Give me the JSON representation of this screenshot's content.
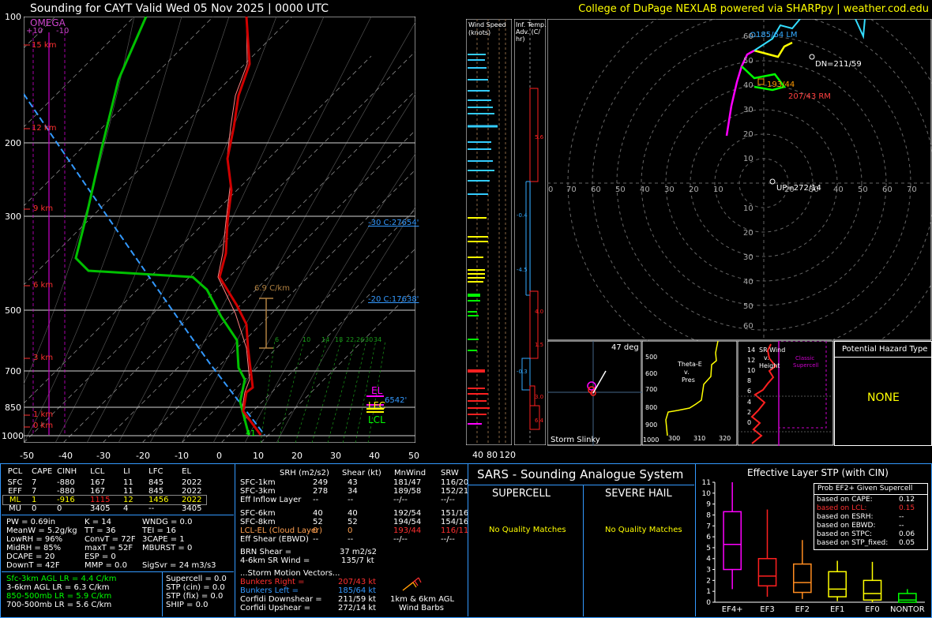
{
  "header": {
    "title": "Sounding for CAYT Valid  Wed 05 Nov 2025 | 0000 UTC",
    "credit": "College of DuPage NEXLAB powered via SHARPpy | weather.cod.edu"
  },
  "skewt": {
    "omega_label": "OMEGA",
    "omega_ticks": [
      "+10",
      "-10"
    ],
    "pressure_ticks": [
      "100",
      "200",
      "300",
      "500",
      "700",
      "850",
      "1000"
    ],
    "temp_ticks": [
      "-50",
      "-40",
      "-30",
      "-20",
      "-10",
      "0",
      "10",
      "20",
      "30",
      "40",
      "50"
    ],
    "height_labels": [
      "15 km",
      "12 km",
      "9 km",
      "6 km",
      "3 km",
      "1 km",
      "0 km"
    ],
    "lapse_label": "6.9 C/km",
    "iso30_label": "-30 C:27654'",
    "iso20_label": "-20 C:17638'",
    "el_label": "EL",
    "lfc_label": "LFC",
    "lcl_label": "LCL",
    "lcl_height": "6542'",
    "surface_temp": "41",
    "mixratio_labels": [
      "6",
      "10",
      "14",
      "18",
      "22",
      "26",
      "30",
      "34"
    ]
  },
  "wind_speed": {
    "title_line1": "Wind Speed",
    "title_line2": "(knots)",
    "ticks": [
      "40",
      "80",
      "120"
    ]
  },
  "inf_temp": {
    "title_line1": "Inf. Temp.",
    "title_line2": "Adv. (C/",
    "title_line3": "hr)",
    "values": [
      "5.6",
      "-0.4",
      "-4.5",
      "4.0",
      "1.5",
      "-0.3",
      "3.0",
      "6.4"
    ]
  },
  "hodograph": {
    "rings_top": [
      "60",
      "50",
      "40",
      "30",
      "20",
      "10"
    ],
    "rings_bottom": [
      "10",
      "20",
      "30",
      "40",
      "50",
      "60"
    ],
    "x_ticks_left": [
      "0",
      "70",
      "60",
      "50",
      "40",
      "30",
      "20",
      "10"
    ],
    "x_ticks_right": [
      "20",
      "30",
      "40",
      "50",
      "60",
      "70"
    ],
    "lm_label": "185/64 LM",
    "dn_label": "DN=211/59",
    "rm_mark_label": "193/44",
    "rm_label": "207/43 RM",
    "up_label": "UP=272/14"
  },
  "slinky": {
    "deg_label": "47 deg",
    "title": "Storm Slinky"
  },
  "theta": {
    "title_line1": "Theta-E",
    "title_line2": "v.",
    "title_line3": "Pres",
    "y_ticks": [
      "500",
      "600",
      "700",
      "800",
      "900",
      "1000"
    ],
    "x_ticks": [
      "300",
      "310",
      "320"
    ]
  },
  "srwind": {
    "title_line1": "SR Wind",
    "title_line2": "v.",
    "title_line3": "Height",
    "classic_line1": "Classic",
    "classic_line2": "Supercell",
    "y_ticks": [
      "14",
      "12",
      "10",
      "8",
      "6",
      "4",
      "2",
      "0"
    ]
  },
  "hazard": {
    "title": "Potential Hazard Type",
    "value": "NONE"
  },
  "parcels": {
    "headers": [
      "PCL",
      "CAPE",
      "CINH",
      "LCL",
      "LI",
      "LFC",
      "EL"
    ],
    "rows": [
      [
        "SFC",
        "7",
        "-880",
        "167",
        "11",
        "845",
        "2022"
      ],
      [
        "EFF",
        "7",
        "-880",
        "167",
        "11",
        "845",
        "2022"
      ],
      [
        "ML",
        "1",
        "-916",
        "1115",
        "12",
        "1456",
        "2022"
      ],
      [
        "MU",
        "0",
        "0",
        "3405",
        "4",
        "--",
        "3405"
      ]
    ]
  },
  "thermo": {
    "col1": [
      "PW = 0.69in",
      "MeanW = 5.2g/kg",
      "LowRH = 96%",
      "MidRH = 85%",
      "DCAPE = 20",
      "DownT = 42F"
    ],
    "col2": [
      "K = 14",
      "TT = 36",
      "ConvT = 72F",
      "maxT = 52F",
      "ESP = 0",
      "MMP = 0.0"
    ],
    "col3": [
      "WNDG = 0.0",
      "TEI = 16",
      "3CAPE = 1",
      "MBURST = 0",
      "",
      "SigSvr = 24 m3/s3"
    ]
  },
  "lapse": {
    "left": [
      "Sfc-3km AGL LR = 4.4 C/km",
      "3-6km AGL LR = 6.3 C/km",
      "850-500mb LR = 5.9 C/km",
      "700-500mb LR = 5.6 C/km"
    ],
    "right": [
      "Supercell = 0.0",
      "STP (cin) = 0.0",
      "STP (fix) = 0.0",
      "SHIP = 0.0"
    ]
  },
  "kinematics": {
    "headers": [
      "SRH (m2/s2)",
      "Shear (kt)",
      "MnWind",
      "SRW"
    ],
    "rows": [
      [
        "SFC-1km",
        "249",
        "43",
        "181/47",
        "116/20"
      ],
      [
        "SFC-3km",
        "278",
        "34",
        "189/58",
        "152/21"
      ],
      [
        "Eff Inflow Layer",
        "--",
        "--",
        "--/--",
        "--/--"
      ],
      [
        "SFC-6km",
        "40",
        "40",
        "192/54",
        "151/16"
      ],
      [
        "SFC-8km",
        "52",
        "52",
        "194/54",
        "154/16"
      ],
      [
        "LCL-EL (Cloud Layer)",
        "0",
        "0",
        "193/44",
        "116/11"
      ],
      [
        "Eff Shear (EBWD)",
        "--",
        "--",
        "--/--",
        "--/--"
      ]
    ],
    "brn_shear": "BRN Shear =",
    "brn_value": "37 m2/s2",
    "sr_wind": "4-6km SR Wind =",
    "sr_value": "135/7 kt",
    "storm_header": "...Storm Motion Vectors...",
    "motions": [
      [
        "Bunkers Right =",
        "207/43 kt"
      ],
      [
        "Bunkers Left =",
        "185/64 kt"
      ],
      [
        "Corfidi Downshear =",
        "211/59 kt"
      ],
      [
        "Corfidi Upshear =",
        "272/14 kt"
      ]
    ],
    "barbs_label1": "1km & 6km AGL",
    "barbs_label2": "Wind Barbs"
  },
  "sars": {
    "title": "SARS - Sounding Analogue System",
    "supercell": "SUPERCELL",
    "hail": "SEVERE HAIL",
    "supercell_result": "No Quality Matches",
    "hail_result": "No Quality Matches"
  },
  "stp": {
    "title": "Effective Layer STP (with CIN)",
    "legend_title": "Prob EF2+ Given Supercell",
    "legend_rows": [
      [
        "based on CAPE:",
        "0.12"
      ],
      [
        "based on LCL:",
        "0.15"
      ],
      [
        "based on ESRH:",
        "--"
      ],
      [
        "based on EBWD:",
        "--"
      ],
      [
        "based on STPC:",
        "0.06"
      ],
      [
        "based on STP_fixed:",
        "0.05"
      ]
    ],
    "y_ticks": [
      "11",
      "10",
      "9",
      "8",
      "7",
      "6",
      "5",
      "4",
      "3",
      "2",
      "1",
      "0"
    ]
  },
  "chart_data": {
    "type": "boxplot",
    "title": "Effective Layer STP (with CIN)",
    "categories": [
      "EF4+",
      "EF3",
      "EF2",
      "EF1",
      "EF0",
      "NONTOR"
    ],
    "ylim": [
      0,
      11
    ],
    "boxes": [
      {
        "name": "EF4+",
        "whisker_low": 1.2,
        "q1": 3.0,
        "median": 5.3,
        "q3": 8.3,
        "whisker_high": 11.0
      },
      {
        "name": "EF3",
        "whisker_low": 0.5,
        "q1": 1.5,
        "median": 2.4,
        "q3": 4.0,
        "whisker_high": 8.5
      },
      {
        "name": "EF2",
        "whisker_low": 0.3,
        "q1": 0.9,
        "median": 1.8,
        "q3": 3.5,
        "whisker_high": 5.7
      },
      {
        "name": "EF1",
        "whisker_low": 0.1,
        "q1": 0.5,
        "median": 1.2,
        "q3": 2.8,
        "whisker_high": 3.8
      },
      {
        "name": "EF0",
        "whisker_low": 0.0,
        "q1": 0.2,
        "median": 0.8,
        "q3": 2.0,
        "whisker_high": 3.7
      },
      {
        "name": "NONTOR",
        "whisker_low": 0.0,
        "q1": 0.0,
        "median": 0.2,
        "q3": 0.8,
        "whisker_high": 1.2
      }
    ],
    "colors": [
      "#ff00ff",
      "#ff2020",
      "#ff8c20",
      "#ffff00",
      "#ffff00",
      "#00ff00"
    ]
  }
}
